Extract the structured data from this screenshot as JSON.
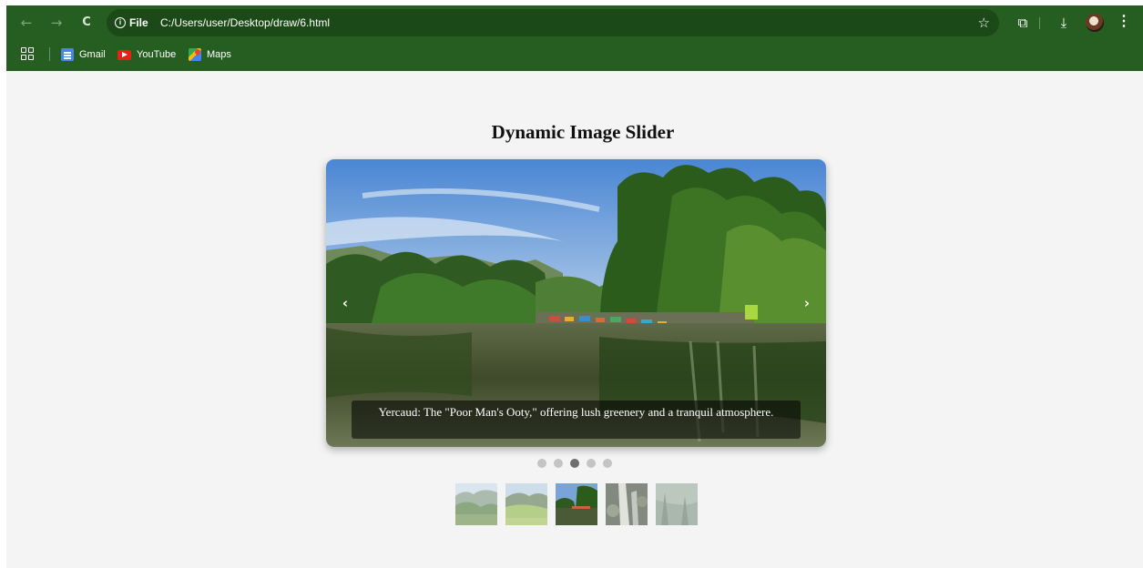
{
  "browser": {
    "site_chip": "File",
    "url": "C:/Users/user/Desktop/draw/6.html",
    "bookmarks": [
      {
        "label": "Gmail",
        "icon": "gmail-icon"
      },
      {
        "label": "YouTube",
        "icon": "youtube-icon"
      },
      {
        "label": "Maps",
        "icon": "maps-icon"
      }
    ],
    "icons": {
      "back": "←",
      "forward": "→",
      "reload": "C",
      "bookmark_star": "☆",
      "extensions": "⧉",
      "download": "⤓",
      "menu": "⋮"
    },
    "theme_color": "#265e22"
  },
  "page": {
    "title": "Dynamic Image Slider",
    "slider": {
      "prev_label": "‹",
      "next_label": "›",
      "caption": "Yercaud: The \"Poor Man's Ooty,\" offering lush greenery and a tranquil atmosphere.",
      "slide_count": 5,
      "active_index": 2
    }
  }
}
